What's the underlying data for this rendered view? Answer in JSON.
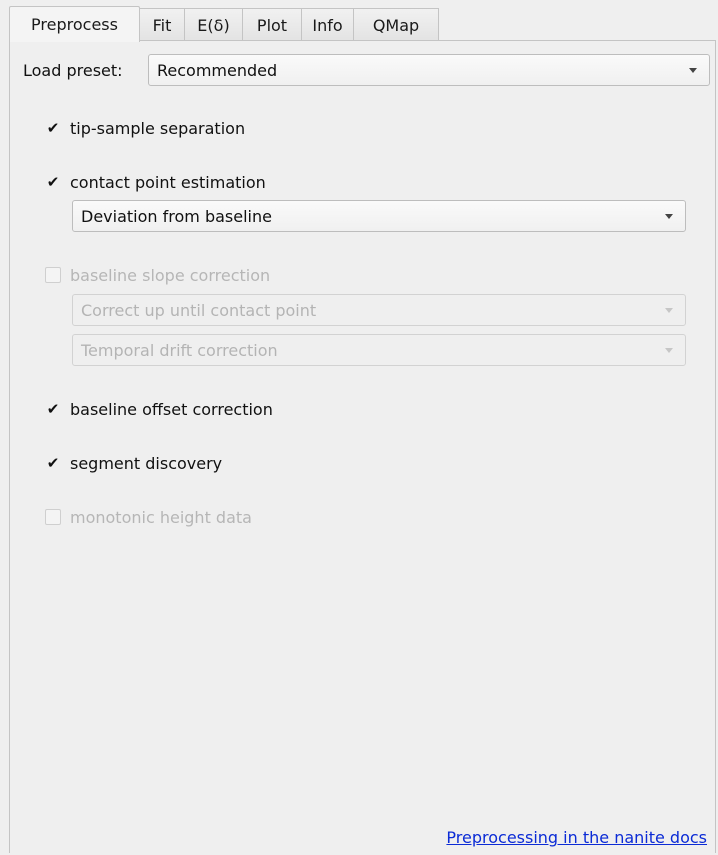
{
  "tabs": [
    {
      "label": "Preprocess",
      "active": true
    },
    {
      "label": "Fit"
    },
    {
      "label": "E(δ)"
    },
    {
      "label": "Plot"
    },
    {
      "label": "Info"
    },
    {
      "label": "QMap"
    }
  ],
  "preset": {
    "label": "Load preset:",
    "value": "Recommended"
  },
  "options": {
    "tip_sample": {
      "label": "tip-sample separation",
      "checked": true,
      "enabled": true
    },
    "contact_point": {
      "label": "contact point estimation",
      "checked": true,
      "enabled": true,
      "method": "Deviation from baseline"
    },
    "baseline_slope": {
      "label": "baseline slope correction",
      "checked": false,
      "enabled": false,
      "mode": "Correct up until contact point",
      "drift": "Temporal drift correction"
    },
    "baseline_offset": {
      "label": "baseline offset correction",
      "checked": true,
      "enabled": true
    },
    "segment_discovery": {
      "label": "segment discovery",
      "checked": true,
      "enabled": true
    },
    "monotonic_height": {
      "label": "monotonic height data",
      "checked": false,
      "enabled": false
    }
  },
  "check_glyph": "✔",
  "docs_link": "Preprocessing in the nanite docs"
}
